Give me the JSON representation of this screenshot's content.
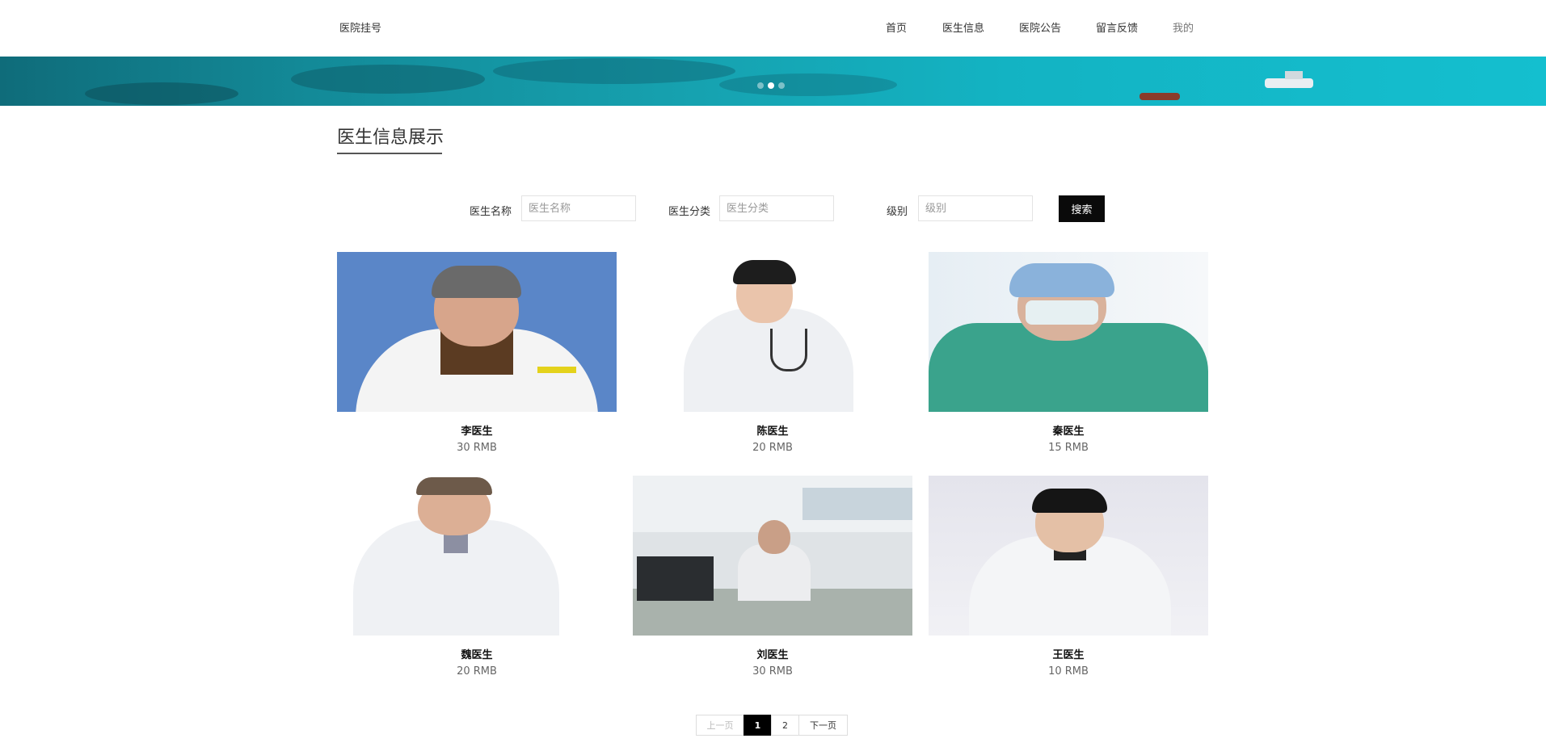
{
  "header": {
    "brand": "医院挂号",
    "nav": [
      {
        "label": "首页"
      },
      {
        "label": "医生信息"
      },
      {
        "label": "医院公告"
      },
      {
        "label": "留言反馈"
      },
      {
        "label": "我的"
      }
    ]
  },
  "banner": {
    "slides": 3,
    "active_slide": 2
  },
  "section": {
    "title": "医生信息展示"
  },
  "search": {
    "name_label": "医生名称",
    "name_placeholder": "医生名称",
    "name_value": "",
    "category_label": "医生分类",
    "category_placeholder": "医生分类",
    "category_value": "",
    "level_label": "级别",
    "level_placeholder": "级别",
    "level_value": "",
    "button_label": "搜索"
  },
  "doctors": [
    {
      "name": "李医生",
      "price": "30 RMB"
    },
    {
      "name": "陈医生",
      "price": "20 RMB"
    },
    {
      "name": "秦医生",
      "price": "15 RMB"
    },
    {
      "name": "魏医生",
      "price": "20 RMB"
    },
    {
      "name": "刘医生",
      "price": "30 RMB"
    },
    {
      "name": "王医生",
      "price": "10 RMB"
    }
  ],
  "pagination": {
    "prev": "上一页",
    "pages": [
      "1",
      "2"
    ],
    "current": "1",
    "next": "下一页"
  },
  "colors": {
    "accent": "#000000",
    "banner_sea": "#14b3c3",
    "photo_bg_blue": "#5a86c8",
    "scrubs": "#3aa38c"
  }
}
